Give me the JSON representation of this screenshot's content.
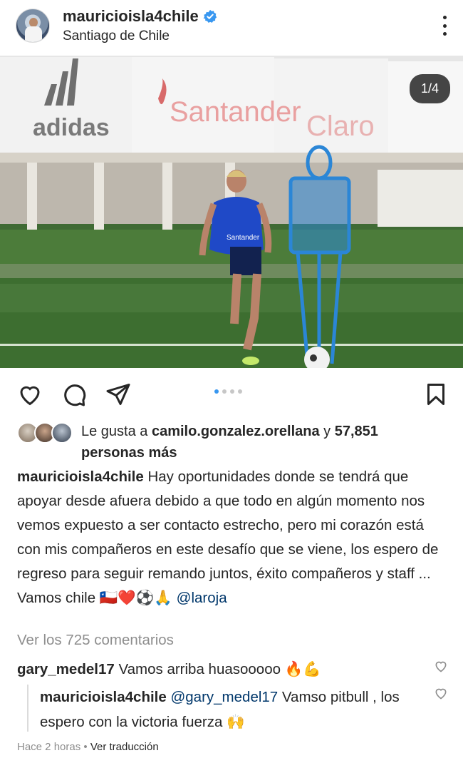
{
  "post": {
    "username": "mauricioisla4chile",
    "location": "Santiago de Chile",
    "counter": "1/4"
  },
  "likes": {
    "prefix": "Le gusta a ",
    "user": "camilo.gonzalez.orellana",
    "joiner": " y ",
    "count": "57,851",
    "suffix": "personas más"
  },
  "caption": {
    "username": "mauricioisla4chile",
    "text": "Hay oportunidades donde se tendrá que apoyar desde afuera debido a que todo en algún momento nos vemos expuesto a ser contacto estrecho, pero mi corazón está con mis compañeros en este desafío que se viene, los espero de regreso para seguir remando juntos, éxito compañeros y staff ...",
    "closing": "Vamos chile 🇨🇱❤️⚽🙏",
    "mention": "@laroja"
  },
  "view_comments": "Ver los 725 comentarios",
  "comments": [
    {
      "username": "gary_medel17",
      "text": "Vamos arriba huasooooo 🔥💪"
    }
  ],
  "reply": {
    "username": "mauricioisla4chile",
    "mention": "@gary_medel17",
    "text": "Vamso pitbull , los espero con la victoria fuerza 🙌"
  },
  "meta": {
    "time": "Hace 2 horas",
    "separator": " • ",
    "translate": "Ver traducción"
  },
  "photo": {
    "banner_brands": [
      "adidas",
      "Santander",
      "Claro"
    ],
    "shirt_text": "Santander"
  },
  "colors": {
    "verified": "#3897f0",
    "mention": "#00376b",
    "muted": "#8e8e8e",
    "shirt": "#1f49c7"
  }
}
